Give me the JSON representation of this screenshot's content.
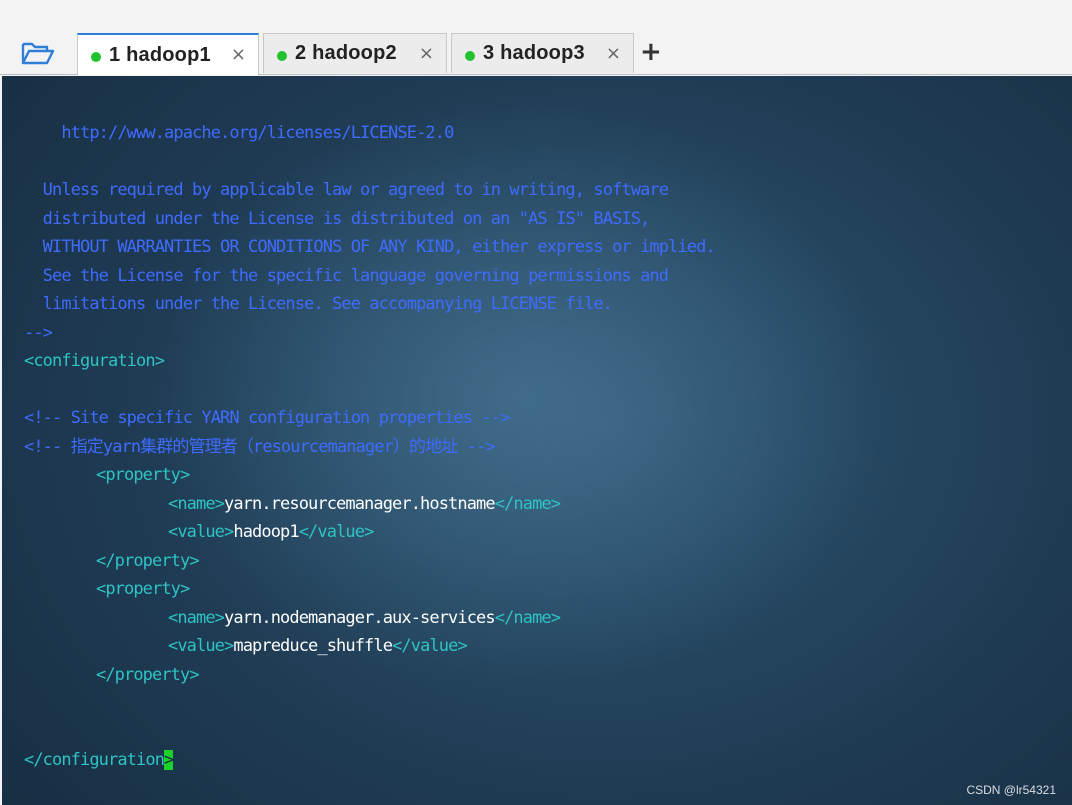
{
  "tabs": [
    {
      "label": "1 hadoop1",
      "close": "×",
      "active": true
    },
    {
      "label": "2 hadoop2",
      "close": "×",
      "active": false
    },
    {
      "label": "3 hadoop3",
      "close": "×",
      "active": false
    }
  ],
  "new_tab_label": "+",
  "terminal": {
    "lines": [
      "    http://www.apache.org/licenses/LICENSE-2.0",
      "  Unless required by applicable law or agreed to in writing, software",
      "  distributed under the License is distributed on an \"AS IS\" BASIS,",
      "  WITHOUT WARRANTIES OR CONDITIONS OF ANY KIND, either express or implied.",
      "  See the License for the specific language governing permissions and",
      "  limitations under the License. See accompanying LICENSE file.",
      "-->",
      "<configuration>",
      "<!-- Site specific YARN configuration properties -->",
      "<!-- 指定yarn集群的管理者（resourcemanager）的地址 -->",
      "<property>",
      "<name>",
      "yarn.resourcemanager.hostname",
      "</name>",
      "<value>",
      "hadoop1",
      "</value>",
      "</property>",
      "<property>",
      "<name>",
      "yarn.nodemanager.aux-services",
      "</name>",
      "<value>",
      "mapreduce_shuffle",
      "</value>",
      "</property>",
      "</configuration"
    ],
    "cursor_char": ">"
  },
  "watermark": "CSDN @lr54321",
  "colors": {
    "comment": "#3f6bff",
    "tag": "#2ec3c4",
    "text": "#ffffff",
    "cursor": "#1cd12a",
    "active_tab_accent": "#2f7fd8",
    "status_dot": "#22c32e"
  },
  "icons": {
    "folder": "folder-open-icon",
    "close": "close-icon",
    "add": "plus-icon"
  }
}
